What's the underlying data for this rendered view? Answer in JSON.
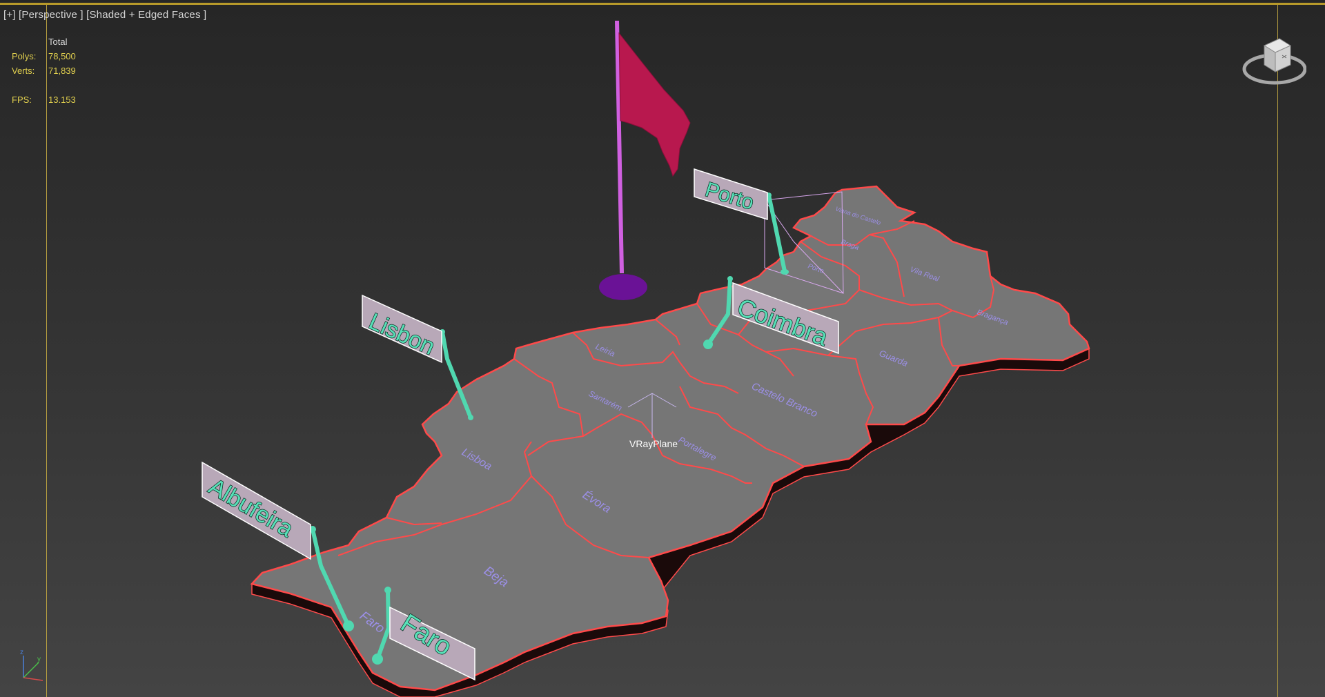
{
  "viewport": {
    "label": "[+] [Perspective ] [Shaded + Edged Faces ]"
  },
  "stats": {
    "total_label": "Total",
    "polys_label": "Polys:",
    "polys_value": "78,500",
    "verts_label": "Verts:",
    "verts_value": "71,839",
    "fps_label": "FPS:",
    "fps_value": "13.153"
  },
  "scene": {
    "object_label": "VRayPlane",
    "city_signs": [
      "Porto",
      "Coimbra",
      "Lisbon",
      "Albufeira",
      "Faro"
    ],
    "district_labels": [
      "Viana do Castelo",
      "Braga",
      "Vila Real",
      "Bragança",
      "Porto",
      "Guarda",
      "Castelo Branco",
      "Leiria",
      "Santarém",
      "Portalegre",
      "Lisboa",
      "Évora",
      "Beja",
      "Faro"
    ]
  },
  "colors": {
    "map_fill": "#727272",
    "map_edge": "#ff4a4a",
    "sign_text": "#58e0b8",
    "pole": "#50d8b0",
    "flag": "#b8184e",
    "flagpole": "#d060e0",
    "flag_base": "#6a1296",
    "district_text": "#9b8fe6",
    "stats_yellow": "#e0cf4e"
  },
  "icons": {
    "viewcube": "viewcube-icon",
    "axis": "axis-tripod-icon"
  }
}
